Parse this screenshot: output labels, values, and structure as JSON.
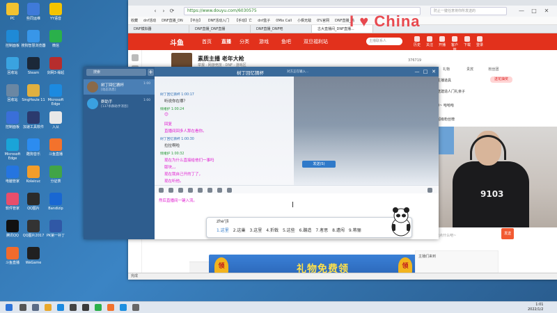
{
  "desktop_icons": [
    {
      "label": "PC",
      "color": "#f2c230"
    },
    {
      "label": "些同运维",
      "color": "#3f7ad9"
    },
    {
      "label": "YY语音",
      "color": "#f5c400"
    },
    {
      "label": "控制面板",
      "color": "#1f8ad6"
    },
    {
      "label": "搜狗智慧浏览器",
      "color": "#3896e8"
    },
    {
      "label": "微信",
      "color": "#2ab04b"
    },
    {
      "label": "回收站",
      "color": "#3aa3e0"
    },
    {
      "label": "Steam",
      "color": "#1b2838"
    },
    {
      "label": "剑网3·缘起",
      "color": "#b62d2d"
    },
    {
      "label": "回收站",
      "color": "#6a87a3"
    },
    {
      "label": "SingHoule 11",
      "color": "#e0b040"
    },
    {
      "label": "Microsoft Edge",
      "color": "#1c8ae0"
    },
    {
      "label": "控制面板",
      "color": "#3a6fd8"
    },
    {
      "label": "加速工具软件",
      "color": "#2b3a6e"
    },
    {
      "label": "入从",
      "color": "#e8e8e8"
    },
    {
      "label": "Microsoft Edge",
      "color": "#1aa4d8"
    },
    {
      "label": "酷狗音乐",
      "color": "#2c8cf0"
    },
    {
      "label": "斗鱼直播",
      "color": "#f3722c"
    },
    {
      "label": "电脑管家",
      "color": "#2575e0"
    },
    {
      "label": "Kolaicuc",
      "color": "#f29d2a"
    },
    {
      "label": "分证表",
      "color": "#41a447"
    },
    {
      "label": "软件管家",
      "color": "#e84e6b"
    },
    {
      "label": "QQ图片",
      "color": "#2b2b2b"
    },
    {
      "label": "Bandizip",
      "color": "#1967d2"
    },
    {
      "label": "腾讯QQ",
      "color": "#111111"
    },
    {
      "label": "QQ图片2017",
      "color": "#333333"
    },
    {
      "label": "PK第一补丁",
      "color": "#3058a6"
    },
    {
      "label": "斗鱼直播",
      "color": "#f26b2c"
    },
    {
      "label": "WeGame",
      "color": "#202020"
    }
  ],
  "browser": {
    "address": "https://www.douyu.com/6030575",
    "search_placeholder": "防止一键任意将你所发送的",
    "watermark": "I ♥ China",
    "bookmarks": [
      "收藏",
      "dnf活动",
      "DNF直播_DN",
      "【平台】",
      "DNF活动入门",
      "【手动】亡",
      "dnf盒子",
      "0Mix Call",
      "小枫无敌",
      "0%官网",
      "DNF直播_热"
    ],
    "tabs": [
      "DNF模拟器",
      "DNF直播_DNF直播",
      "DNF直播_DNF吧",
      "古大直播间_DNF直播..."
    ],
    "status_text": "完成"
  },
  "douyu": {
    "logo": "斗鱼",
    "nav": [
      "首页",
      "直播",
      "分类",
      "游戏",
      "鱼吧",
      "双旦福利站"
    ],
    "search_placeholder": "主播联系人",
    "tools": [
      "历史",
      "关注",
      "开播",
      "客户端",
      "下载",
      "登录"
    ],
    "room_title": "素质主播 老年大枪",
    "room_sub": "举报 · 网游竞技 · DNF · 游戏区",
    "fans": "376719",
    "right_tabs": [
      "礼物",
      "贵宾",
      "粉丝团"
    ],
    "right_items": [
      "主播道具",
      "收到开奖",
      "送建造人门礼亲子",
      "0~ 哈哈哈",
      "超级粉丝榜"
    ],
    "right_pill": "送花抽奖",
    "send_label": "发送",
    "send_placeholder": "说点什么吧~",
    "banner_text": "礼物免费领",
    "banner_coin": "领",
    "ad_text": "主播们来到",
    "jersey": "9103"
  },
  "qq": {
    "search_placeholder": "搜索",
    "title": "树丁回忆猜杯",
    "status": "对方正在输入...",
    "contacts": [
      {
        "name": "树丁回忆猜杯",
        "sub": "[动态消息]",
        "time": "1:00",
        "color": "#8a6a4a"
      },
      {
        "name": "群助手",
        "sub": "[137条群助手消息]",
        "time": "1:00",
        "color": "#3aa0e0"
      }
    ],
    "messages": [
      {
        "meta": "树丁回忆猜杯 1:00:17",
        "lines": [
          "听说你在哪？"
        ],
        "self": false
      },
      {
        "meta": "情绪护 1:00:24",
        "lines": [
          "😊"
        ],
        "self": true
      },
      {
        "meta": "",
        "lines": [
          "回复",
          "直播间回多人那在看你。"
        ],
        "self": true
      },
      {
        "meta": "树丁回忆猜杯 1:00:30",
        "lines": [
          "拉拉啊啦"
        ],
        "self": false
      },
      {
        "meta": "情绪护 1:00:32",
        "lines": [
          "现在为什么直接给他们一事吗",
          "版块，，",
          "现在我自己开的丁了，",
          "现在听他。"
        ],
        "self": true
      }
    ],
    "typed_text": "然后直播间一键入流。",
    "send": "发送(S)"
  },
  "ime": {
    "pinyin": "zhe'|li",
    "candidates": [
      "1.这里",
      "2.这巢",
      "3.这里",
      "4.折戟",
      "5.这些",
      "6.蹦造",
      "7.者思",
      "8.遭闯",
      "9.蒋骊"
    ]
  },
  "clock": {
    "time": "1:01",
    "date": "2022/1/2"
  }
}
